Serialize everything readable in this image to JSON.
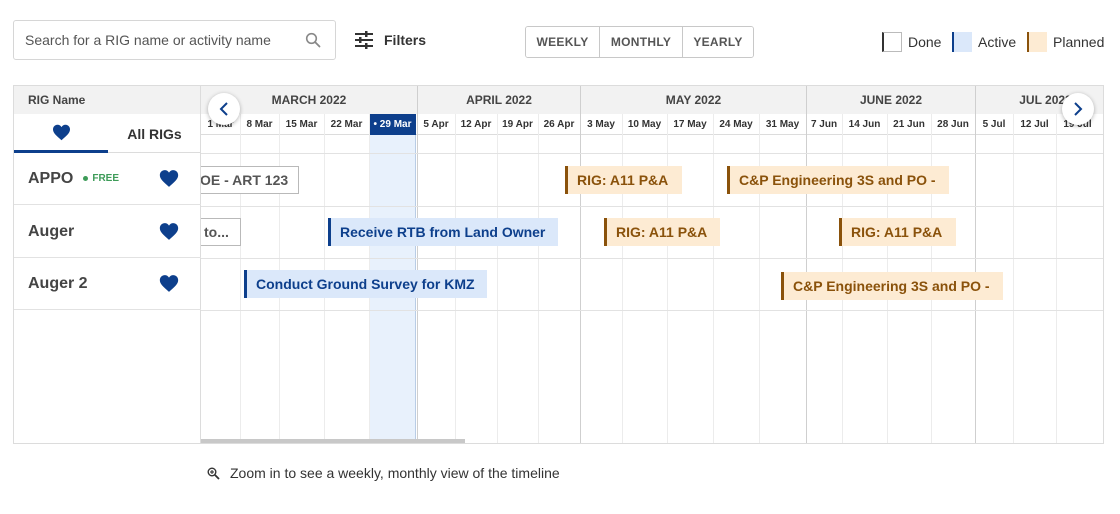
{
  "search": {
    "placeholder": "Search for a RIG name or activity name",
    "value": "",
    "icon": "search-icon"
  },
  "filters": {
    "label": "Filters",
    "icon": "sliders-icon"
  },
  "view_tabs": [
    "WEEKLY",
    "MONTHLY",
    "YEARLY"
  ],
  "legend": [
    {
      "label": "Done",
      "color": "#ffffff",
      "edge": "#333333"
    },
    {
      "label": "Active",
      "color": "#dbe8fa",
      "edge": "#0d3f8c"
    },
    {
      "label": "Planned",
      "color": "#fdebd3",
      "edge": "#8a520b"
    }
  ],
  "left": {
    "header": "RIG Name",
    "tabs": [
      {
        "icon": "heart-icon",
        "label": ""
      },
      {
        "icon": "",
        "label": "All RIGs"
      }
    ],
    "rows": [
      {
        "name": "APPO",
        "badge": "FREE"
      },
      {
        "name": "Auger",
        "badge": ""
      },
      {
        "name": "Auger 2",
        "badge": ""
      }
    ]
  },
  "timeline": {
    "months": [
      "MARCH 2022",
      "APRIL 2022",
      "MAY 2022",
      "JUNE 2022",
      "JUL 2022"
    ],
    "weeks": [
      "1 Mar",
      "8 Mar",
      "15 Mar",
      "22 Mar",
      "29 Mar",
      "5 Apr",
      "12 Apr",
      "19 Apr",
      "26 Apr",
      "3 May",
      "10 May",
      "17 May",
      "24 May",
      "31 May",
      "7 Jun",
      "14 Jun",
      "21 Jun",
      "28 Jun",
      "5 Jul",
      "12 Jul",
      "19 Jul"
    ],
    "today_week": "29 Mar",
    "today_prefix": "• "
  },
  "activities": [
    {
      "row": 0,
      "label": "OE - ART 123",
      "status": "done"
    },
    {
      "row": 0,
      "label": "RIG: A11 P&A",
      "status": "planned"
    },
    {
      "row": 0,
      "label": "C&P Engineering 3S and PO -",
      "status": "planned"
    },
    {
      "row": 1,
      "label": "to...",
      "status": "done"
    },
    {
      "row": 1,
      "label": "Receive RTB from Land Owner",
      "status": "active"
    },
    {
      "row": 1,
      "label": "RIG: A11 P&A",
      "status": "planned"
    },
    {
      "row": 1,
      "label": "RIG: A11 P&A",
      "status": "planned"
    },
    {
      "row": 2,
      "label": "Conduct Ground Survey for KMZ",
      "status": "active"
    },
    {
      "row": 2,
      "label": "C&P Engineering 3S and PO -",
      "status": "planned"
    }
  ],
  "hint": {
    "icon": "zoom-in-icon",
    "text": "Zoom in to see a weekly, monthly view of the timeline"
  }
}
